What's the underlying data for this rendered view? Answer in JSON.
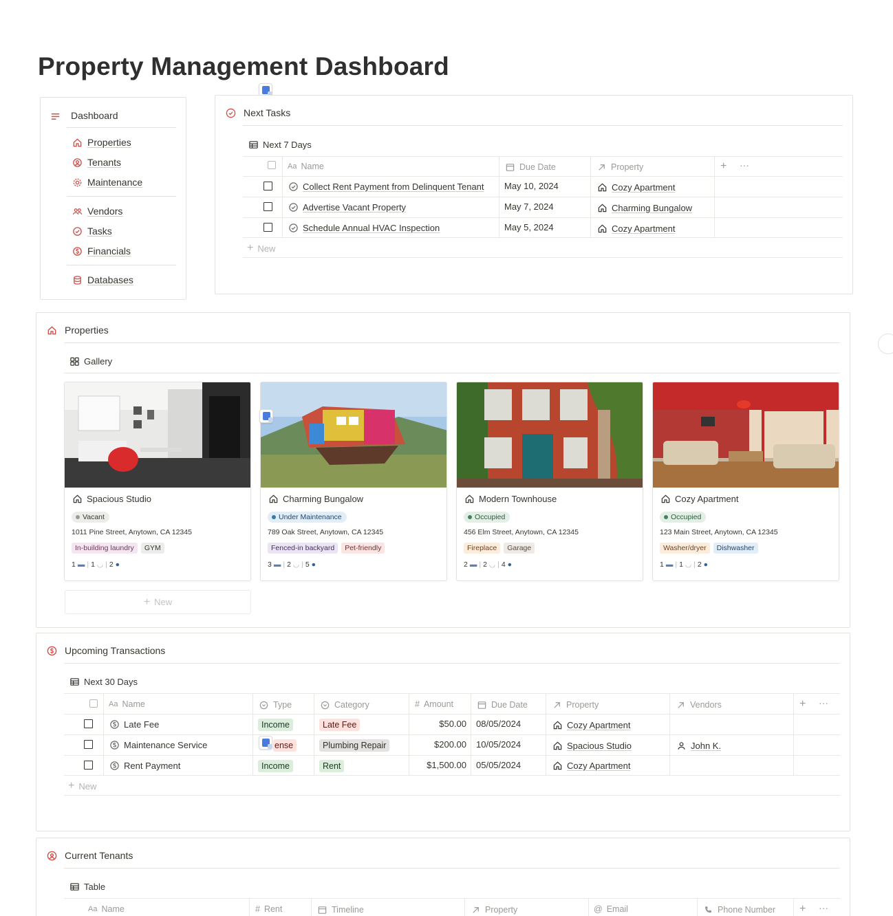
{
  "page": {
    "title": "Property Management Dashboard"
  },
  "sidebar": {
    "heading": "Dashboard",
    "groups": [
      [
        {
          "label": "Properties",
          "icon": "house-icon"
        },
        {
          "label": "Tenants",
          "icon": "person-circle-icon"
        },
        {
          "label": "Maintenance",
          "icon": "gear-icon"
        }
      ],
      [
        {
          "label": "Vendors",
          "icon": "people-icon"
        },
        {
          "label": "Tasks",
          "icon": "check-circle-icon"
        },
        {
          "label": "Financials",
          "icon": "dollar-circle-icon"
        }
      ],
      [
        {
          "label": "Databases",
          "icon": "database-icon"
        }
      ]
    ]
  },
  "next_tasks": {
    "heading": "Next Tasks",
    "view": "Next 7 Days",
    "columns": {
      "name": "Name",
      "due": "Due Date",
      "property": "Property"
    },
    "rows": [
      {
        "name": "Collect Rent Payment from Delinquent Tenant",
        "due": "May 10, 2024",
        "property": "Cozy Apartment"
      },
      {
        "name": "Advertise Vacant Property",
        "due": "May 7, 2024",
        "property": "Charming Bungalow"
      },
      {
        "name": "Schedule Annual HVAC Inspection",
        "due": "May 5, 2024",
        "property": "Cozy Apartment"
      }
    ],
    "new_label": "New"
  },
  "properties": {
    "heading": "Properties",
    "view": "Gallery",
    "cards": [
      {
        "name": "Spacious Studio",
        "status": "Vacant",
        "status_bg": "#ececeb",
        "status_dot": "#9b9a97",
        "status_fg": "#37352f",
        "address": "1011 Pine Street, Anytown, CA 12345",
        "features": [
          {
            "label": "In-building laundry",
            "bg": "#f4e6f0",
            "fg": "#6d3c5f"
          },
          {
            "label": "GYM",
            "bg": "#ececeb",
            "fg": "#37352f"
          }
        ],
        "beds": "1",
        "baths": "1",
        "people": "2"
      },
      {
        "name": "Charming Bungalow",
        "status": "Under Maintenance",
        "status_bg": "#e1eef7",
        "status_dot": "#337ea9",
        "status_fg": "#28456c",
        "address": "789 Oak Street, Anytown, CA 12345",
        "features": [
          {
            "label": "Fenced-in backyard",
            "bg": "#ebe4f2",
            "fg": "#492f64"
          },
          {
            "label": "Pet-friendly",
            "bg": "#fbe4e4",
            "fg": "#6e3630"
          }
        ],
        "beds": "3",
        "baths": "2",
        "people": "5"
      },
      {
        "name": "Modern Townhouse",
        "status": "Occupied",
        "status_bg": "#e3efe5",
        "status_dot": "#448361",
        "status_fg": "#2b593f",
        "address": "456 Elm Street, Anytown, CA 12345",
        "features": [
          {
            "label": "Fireplace",
            "bg": "#fbecdc",
            "fg": "#70431f"
          },
          {
            "label": "Garage",
            "bg": "#eeeae6",
            "fg": "#5c4a3c"
          }
        ],
        "beds": "2",
        "baths": "2",
        "people": "4"
      },
      {
        "name": "Cozy Apartment",
        "status": "Occupied",
        "status_bg": "#e3efe5",
        "status_dot": "#448361",
        "status_fg": "#2b593f",
        "address": "123 Main Street, Anytown, CA 12345",
        "features": [
          {
            "label": "Washer/dryer",
            "bg": "#fbecdc",
            "fg": "#70431f"
          },
          {
            "label": "Dishwasher",
            "bg": "#e1eef7",
            "fg": "#28456c"
          }
        ],
        "beds": "1",
        "baths": "1",
        "people": "2"
      }
    ],
    "new_label": "New"
  },
  "transactions": {
    "heading": "Upcoming Transactions",
    "view": "Next 30 Days",
    "columns": {
      "name": "Name",
      "type": "Type",
      "category": "Category",
      "amount": "Amount",
      "due": "Due Date",
      "property": "Property",
      "vendors": "Vendors"
    },
    "rows": [
      {
        "name": "Late Fee",
        "type": "Income",
        "type_bg": "#dbeddb",
        "type_fg": "#1c3829",
        "category": "Late Fee",
        "cat_bg": "#ffe2dd",
        "cat_fg": "#5d1715",
        "amount": "$50.00",
        "due": "08/05/2024",
        "property": "Cozy Apartment",
        "vendor": ""
      },
      {
        "name": "Maintenance Service",
        "type": "Expense",
        "type_visible": "ense",
        "type_bg": "#ffe2dd",
        "type_fg": "#5d1715",
        "category": "Plumbing Repair",
        "cat_bg": "#e3e2e0",
        "cat_fg": "#32302c",
        "amount": "$200.00",
        "due": "10/05/2024",
        "property": "Spacious Studio",
        "vendor": "John K."
      },
      {
        "name": "Rent Payment",
        "type": "Income",
        "type_bg": "#dbeddb",
        "type_fg": "#1c3829",
        "category": "Rent",
        "cat_bg": "#dbeddb",
        "cat_fg": "#1c3829",
        "amount": "$1,500.00",
        "due": "05/05/2024",
        "property": "Cozy Apartment",
        "vendor": ""
      }
    ],
    "new_label": "New"
  },
  "tenants": {
    "heading": "Current Tenants",
    "view": "Table",
    "columns": {
      "name": "Name",
      "rent": "Rent",
      "timeline": "Timeline",
      "property": "Property",
      "email": "Email",
      "phone": "Phone Number"
    }
  },
  "colors": {
    "accent": "#d44c47",
    "border": "#e3e2df",
    "muted": "#9b9a97"
  }
}
